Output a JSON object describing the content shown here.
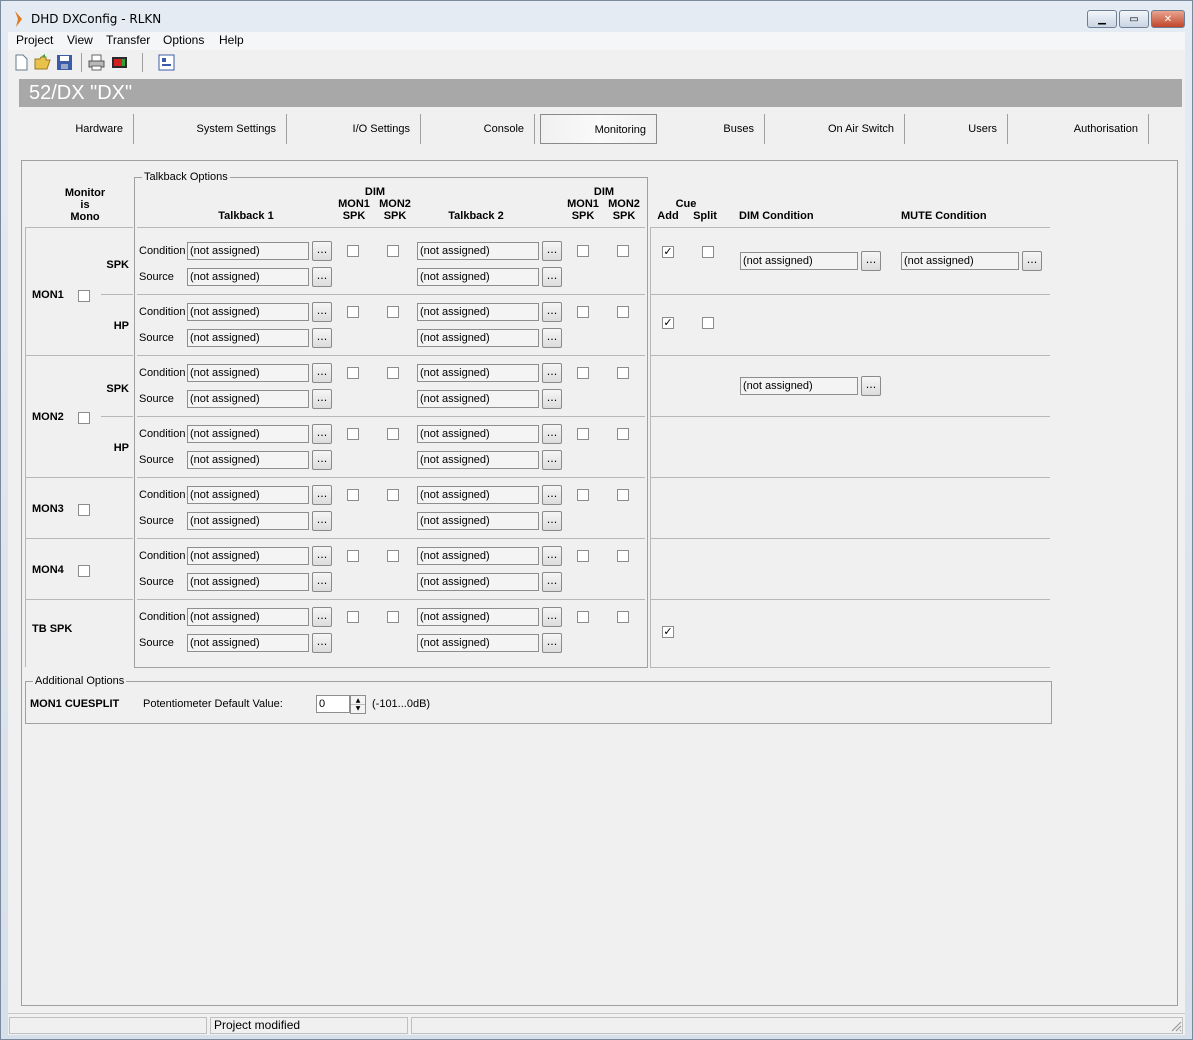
{
  "window": {
    "title": "DHD DXConfig - RLKN"
  },
  "menu": [
    "Project",
    "View",
    "Transfer",
    "Options",
    "Help"
  ],
  "device_header": "52/DX \"DX\"",
  "tabs": [
    "Hardware",
    "System Settings",
    "I/O Settings",
    "Console",
    "Monitoring",
    "Buses",
    "On Air Switch",
    "Users",
    "Authorisation"
  ],
  "active_tab": "Monitoring",
  "monitoring": {
    "talkback_group_title": "Talkback Options",
    "headers": {
      "monitor_mono_1": "Monitor",
      "monitor_mono_2": "is",
      "monitor_mono_3": "Mono",
      "talkback1": "Talkback 1",
      "talkback2": "Talkback 2",
      "dim": "DIM",
      "mon1": "MON1",
      "mon2": "MON2",
      "spk": "SPK",
      "cue": "Cue",
      "add": "Add",
      "split": "Split",
      "dim_condition": "DIM Condition",
      "mute_condition": "MUTE Condition"
    },
    "labels": {
      "condition": "Condition",
      "source": "Source",
      "spk": "SPK",
      "hp": "HP"
    },
    "monitors": [
      {
        "name": "MON1",
        "mono": false
      },
      {
        "name": "MON2",
        "mono": false
      },
      {
        "name": "MON3",
        "mono": false
      },
      {
        "name": "MON4",
        "mono": false
      },
      {
        "name": "TB SPK"
      }
    ],
    "not_assigned": "(not assigned)",
    "browse_label": "...",
    "check_mark": "✓",
    "cue_add": [
      true,
      true,
      false,
      false,
      false,
      false,
      true
    ],
    "cue_split": [
      false,
      false
    ],
    "dim_condition_values": [
      "(not assigned)",
      "(not assigned)"
    ],
    "mute_condition_values": [
      "(not assigned)"
    ]
  },
  "additional_options": {
    "title": "Additional Options",
    "label": "MON1 CUESPLIT",
    "pot_label": "Potentiometer Default Value:",
    "pot_value": "0",
    "range": "(-101...0dB)"
  },
  "status": {
    "message": "Project modified"
  }
}
